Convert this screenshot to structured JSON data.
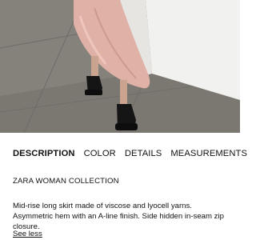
{
  "tabs": [
    {
      "label": "DESCRIPTION",
      "active": true
    },
    {
      "label": "COLOR",
      "active": false
    },
    {
      "label": "DETAILS",
      "active": false
    },
    {
      "label": "MEASUREMENTS",
      "active": false
    }
  ],
  "collection_title": "ZARA WOMAN COLLECTION",
  "description_text": "Mid-rise long skirt made of viscose and lyocell yarns. Asymmetric hem with an A-line finish. Side hidden in-seam zip closure.",
  "see_less_label": "See less",
  "colors": {
    "text": "#111111",
    "background": "#ffffff",
    "skirt": "#e0b1a6",
    "floor": "#7f7b76",
    "wall": "#f1f1ef"
  }
}
